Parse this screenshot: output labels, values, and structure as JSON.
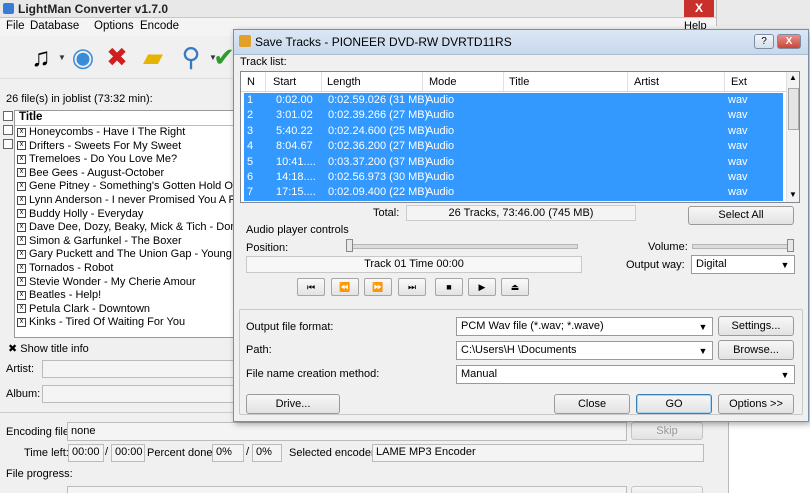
{
  "main": {
    "title": "LightMan Converter v1.7.0",
    "close_glyph": "X",
    "menu": [
      "File",
      "Database",
      "Options",
      "Encode"
    ],
    "help_label": "Help",
    "toolbar_icons": [
      "au-music-icon",
      "add-cd-icon",
      "delete-icon",
      "clear-folder-icon",
      "search-icon",
      "check-icon"
    ],
    "joblist_label": "26 file(s) in joblist (73:32 min):",
    "list_header": "Title",
    "items": [
      "Honeycombs - Have I The Right",
      "Drifters - Sweets For My Sweet",
      "Tremeloes - Do You Love Me?",
      "Bee Gees - August-October",
      "Gene Pitney - Something's Gotten Hold Of My he",
      "Lynn Anderson - I never Promised You A Rose G",
      "Buddy Holly - Everyday",
      "Dave Dee, Dozy, Beaky, Mick & Tich - Don Juai",
      "Simon & Garfunkel - The Boxer",
      "Gary Puckett and The Union Gap - Young Girl",
      "Tornados - Robot",
      "Stevie Wonder - My Cherie Amour",
      "Beatles - Help!",
      "Petula Clark - Downtown",
      "Kinks - Tired Of Waiting For You"
    ],
    "show_title_info": "Show title info",
    "artist_label": "Artist:",
    "album_label": "Album:",
    "encoding_file_label": "Encoding file:",
    "encoding_file_value": "none",
    "skip_label": "Skip",
    "time_left_label": "Time left:",
    "time_left_a": "00:00",
    "time_left_b": "00:00",
    "percent_done_label": "Percent done:",
    "percent_a": "0%",
    "percent_b": "0%",
    "selected_encoder_label": "Selected encoder:",
    "selected_encoder_value": "LAME MP3 Encoder",
    "file_progress_label": "File progress:"
  },
  "dialog": {
    "title": "Save Tracks - PIONEER  DVD-RW  DVRTD11RS",
    "help_glyph": "?",
    "close_glyph": "X",
    "tracklist_label": "Track list:",
    "columns": [
      "N",
      "Start",
      "Length",
      "Mode",
      "Title",
      "Artist",
      "Ext"
    ],
    "tracks": [
      {
        "n": "1",
        "start": "0:02.00",
        "length": "0:02.59.026 (31 MB)",
        "mode": "Audio",
        "ext": "wav"
      },
      {
        "n": "2",
        "start": "3:01.02",
        "length": "0:02.39.266 (27 MB)",
        "mode": "Audio",
        "ext": "wav"
      },
      {
        "n": "3",
        "start": "5:40.22",
        "length": "0:02.24.600 (25 MB)",
        "mode": "Audio",
        "ext": "wav"
      },
      {
        "n": "4",
        "start": "8:04.67",
        "length": "0:02.36.200 (27 MB)",
        "mode": "Audio",
        "ext": "wav"
      },
      {
        "n": "5",
        "start": "10:41....",
        "length": "0:03.37.200 (37 MB)",
        "mode": "Audio",
        "ext": "wav"
      },
      {
        "n": "6",
        "start": "14:18....",
        "length": "0:02.56.973 (30 MB)",
        "mode": "Audio",
        "ext": "wav"
      },
      {
        "n": "7",
        "start": "17:15....",
        "length": "0:02.09.400 (22 MB)",
        "mode": "Audio",
        "ext": "wav"
      }
    ],
    "total_label": "Total:",
    "total_value": "26 Tracks,   73:46.00 (745 MB)",
    "select_all": "Select All",
    "audio_player_controls": "Audio player controls",
    "position_label": "Position:",
    "volume_label": "Volume:",
    "volume_level": 1.0,
    "position_level": 0.0,
    "status_text": "Track 01 Time 00:00",
    "output_way_label": "Output way:",
    "output_way_value": "Digital",
    "player_buttons": [
      "first-track-icon",
      "rewind-icon",
      "fast-forward-icon",
      "last-track-icon",
      "stop-icon",
      "play-icon",
      "eject-icon"
    ],
    "player_glyphs": [
      "⏮",
      "⏪",
      "⏩",
      "⏭",
      "■",
      "▶",
      "⏏"
    ],
    "output_format_label": "Output file format:",
    "output_format_value": "PCM Wav file (*.wav; *.wave)",
    "settings_label": "Settings...",
    "path_label": "Path:",
    "path_value": "C:\\Users\\H                         \\Documents",
    "browse_label": "Browse...",
    "fncm_label": "File name creation method:",
    "fncm_value": "Manual",
    "drive_label": "Drive...",
    "close_label": "Close",
    "go_label": "GO",
    "options_label": "Options >>"
  },
  "colors": {
    "selection": "#3399ff",
    "dialog_title": "#c8d8ec"
  }
}
